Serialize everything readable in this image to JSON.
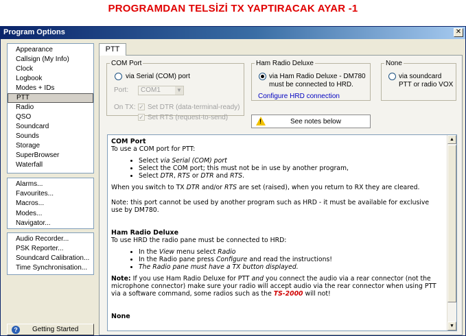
{
  "caption": "PROGRAMDAN TELSİZİ TX YAPTIRACAK AYAR -1",
  "window": {
    "title": "Program Options",
    "close": "✕"
  },
  "sidebar": {
    "group1": [
      "Appearance",
      "Callsign (My Info)",
      "Clock",
      "Logbook",
      "Modes + IDs",
      "PTT",
      "Radio",
      "QSO",
      "Soundcard",
      "Sounds",
      "Storage",
      "SuperBrowser",
      "Waterfall"
    ],
    "selected": "PTT",
    "group2": [
      "Alarms...",
      "Favourites...",
      "Macros...",
      "Modes...",
      "Navigator..."
    ],
    "group3": [
      "Audio Recorder...",
      "PSK Reporter...",
      "Soundcard Calibration...",
      "Time Synchronisation..."
    ],
    "getting_started": "Getting Started"
  },
  "tab": {
    "label": "PTT"
  },
  "com_port": {
    "legend": "COM Port",
    "radio_label": "via Serial (COM) port",
    "port_label": "Port:",
    "port_value": "COM1",
    "on_tx_label": "On TX:",
    "dtr_label": "Set DTR (data-terminal-ready)",
    "rts_label": "Set RTS (request-to-send)"
  },
  "hrd": {
    "legend": "Ham Radio Deluxe",
    "radio_line1": "via Ham Radio Deluxe - DM780",
    "radio_line2": "must be connected to HRD.",
    "link": "Configure HRD connection"
  },
  "none": {
    "legend": "None",
    "radio_line1": "via soundcard",
    "radio_line2": "PTT or radio VOX"
  },
  "notes_button": "See notes below",
  "notes": {
    "com_heading": "COM Port",
    "com_intro": "To use a COM port for PTT:",
    "com_b1_pre": "Select ",
    "com_b1_em": "via Serial (COM) port",
    "com_b2": "Select the COM port; this must not be in use by another program,",
    "com_b3_pre": "Select ",
    "com_b3_em1": "DTR",
    "com_b3_sep1": ", ",
    "com_b3_em2": "RTS",
    "com_b3_sep2": " or ",
    "com_b3_em3": "DTR",
    "com_b3_sep3": " and ",
    "com_b3_em4": "RTS",
    "com_b3_end": ".",
    "com_switch_pre": "When you switch to TX ",
    "com_switch_em1": "DTR",
    "com_switch_mid": " and/or ",
    "com_switch_em2": "RTS",
    "com_switch_post": " are set (raised), when you return to RX they are cleared.",
    "com_note": "Note: this port cannot be used by another program such as HRD - it must be available for exclusive use by DM780.",
    "hrd_heading": "Ham Radio Deluxe",
    "hrd_intro": "To use HRD the radio pane must be connected to HRD:",
    "hrd_b1_pre": "In the ",
    "hrd_b1_em1": "View",
    "hrd_b1_mid": " menu select ",
    "hrd_b1_em2": "Radio",
    "hrd_b2_pre": "In the Radio pane press ",
    "hrd_b2_em": "Configure",
    "hrd_b2_post": " and read the instructions!",
    "hrd_b3": "The Radio pane must have a TX button displayed.",
    "hrd_note_bold": "Note:",
    "hrd_note_a": " If you use Ham Radio Deluxe for PTT ",
    "hrd_note_em": "and",
    "hrd_note_b": " you connect the audio via a rear connector (not the microphone connector) make sure your radio will accept audio via the rear connector when using PTT via a software command, some radios such as the ",
    "hrd_note_red": "TS-2000",
    "hrd_note_c": " will not!",
    "none_heading": "None"
  },
  "colors": {
    "caption": "#e00000",
    "titlebar": "#0a246a",
    "link": "#0000c0"
  }
}
